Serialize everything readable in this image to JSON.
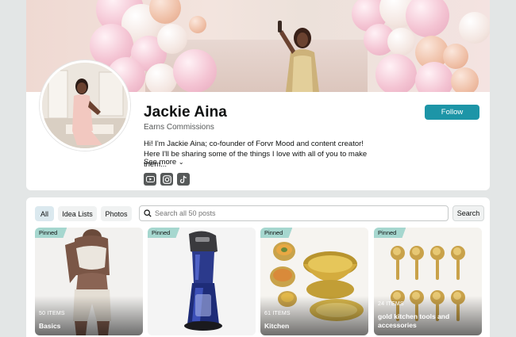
{
  "profile": {
    "name": "Jackie Aina",
    "subtitle": "Earns Commissions",
    "bio": "Hi! I'm Jackie Aina; co-founder of Forvr Mood and content creator! Here I'll be sharing some of the things I love with all of you to make them...",
    "see_more": "See more",
    "follow_label": "Follow",
    "socials": [
      "youtube-icon",
      "instagram-icon",
      "tiktok-icon"
    ]
  },
  "filters": {
    "tabs": [
      "All",
      "Idea Lists",
      "Photos"
    ],
    "active": "All",
    "search_placeholder": "Search all 50 posts",
    "search_button": "Search"
  },
  "lists": [
    {
      "badge": "Pinned",
      "count": "50 ITEMS",
      "title": "Basics"
    },
    {
      "badge": "Pinned",
      "count": "",
      "title": ""
    },
    {
      "badge": "Pinned",
      "count": "61 ITEMS",
      "title": "Kitchen"
    },
    {
      "badge": "Pinned",
      "count": "24 ITEMS",
      "title": "gold kitchen tools and accessories"
    }
  ],
  "colors": {
    "accent": "#1d95a7",
    "pinned_badge": "#a6d7cf",
    "active_tab": "#dbe9ef"
  }
}
